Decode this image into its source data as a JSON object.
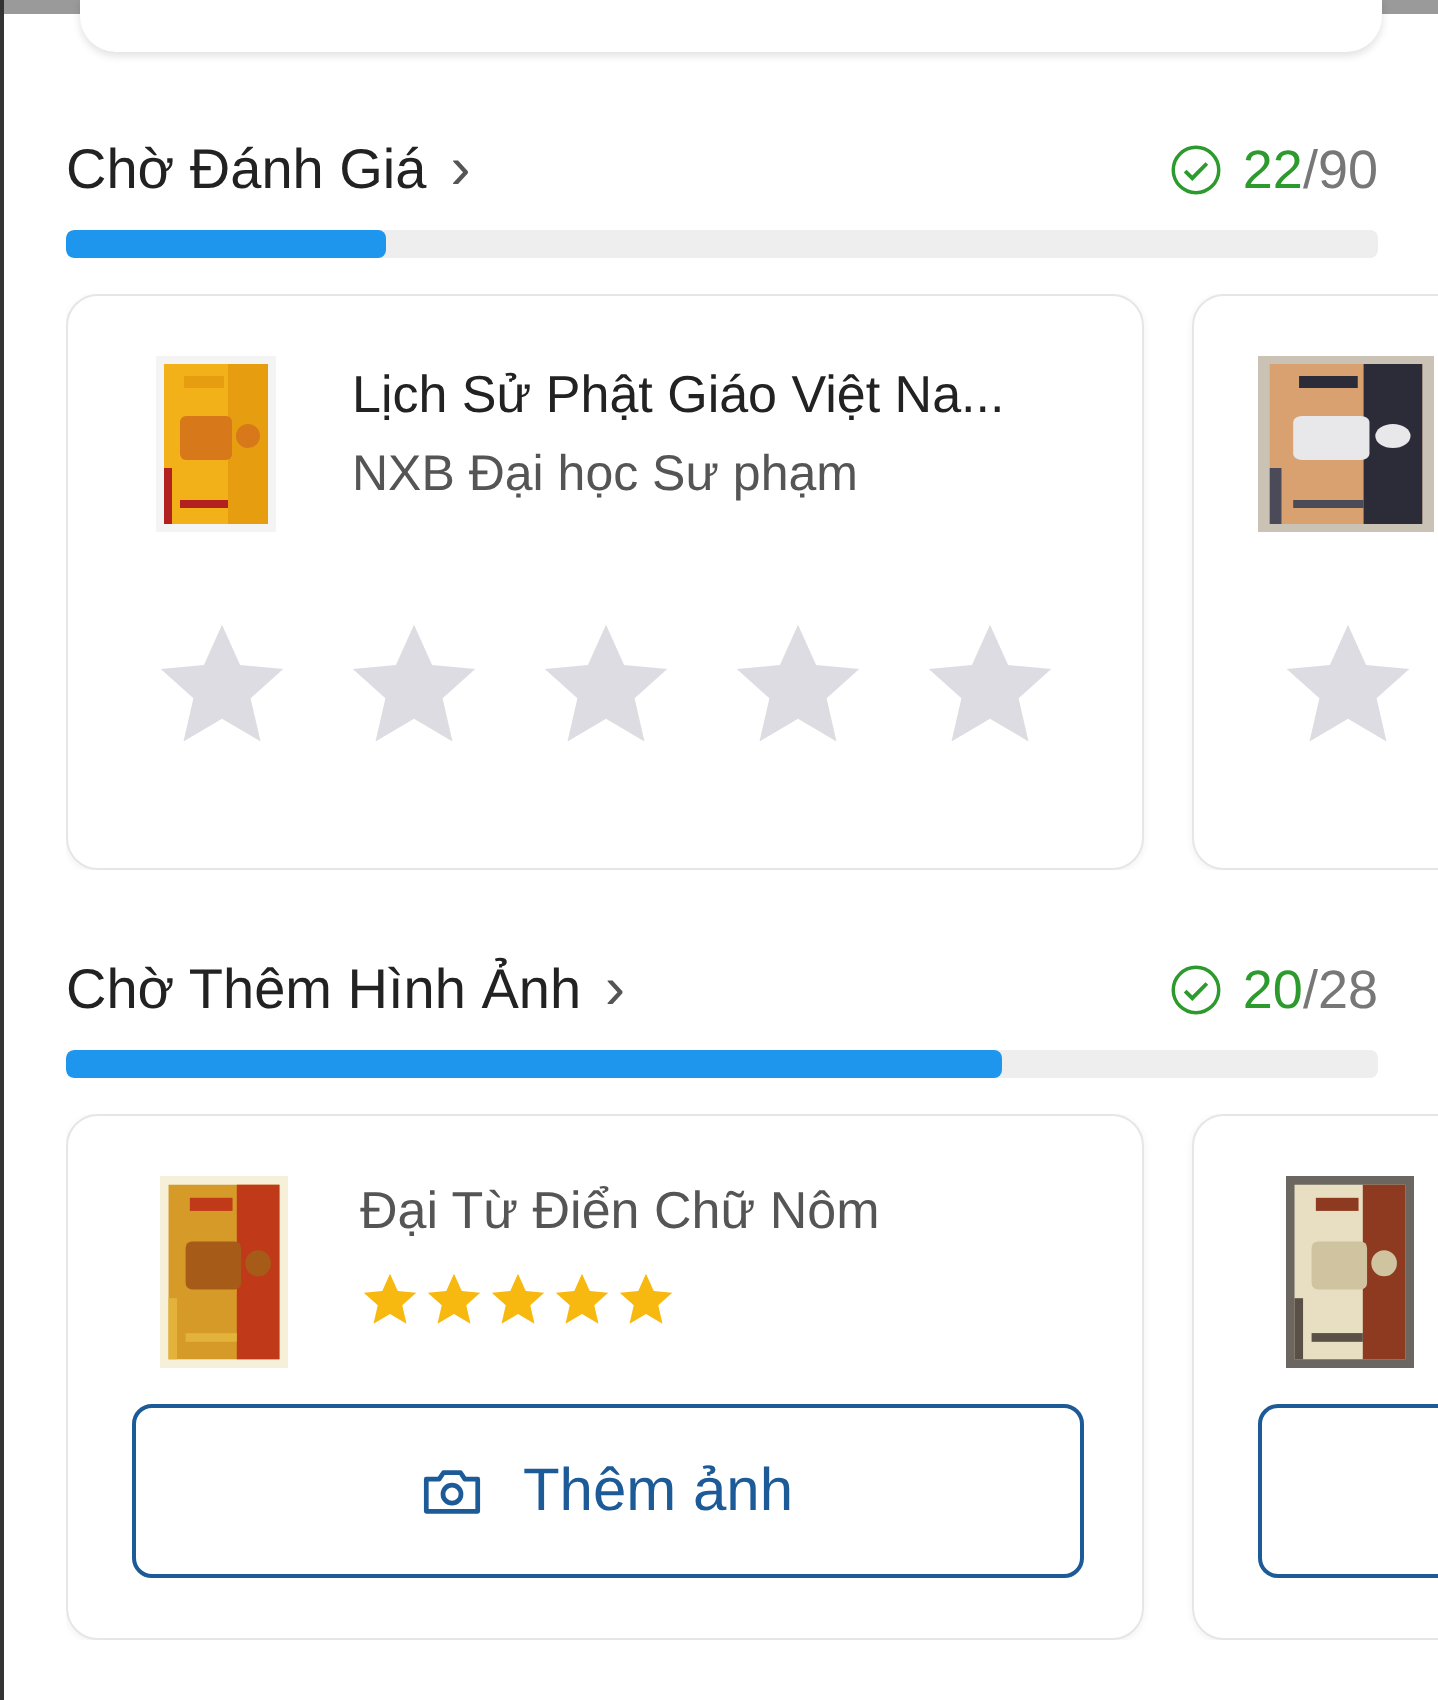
{
  "sections": [
    {
      "kind": "rate",
      "title": "Chờ Đánh Giá",
      "chevron": "›",
      "done": "22",
      "total": "/90",
      "level": 0.244,
      "cards": [
        {
          "cover": {
            "kind": "picture"
          },
          "title": "Lịch Sử Phật Giáo Việt Na...",
          "publisher": "NXB Đại học Sư phạm",
          "stars": 0
        },
        {
          "cover": {
            "kind": "picture"
          }
        }
      ]
    },
    {
      "title": "Chờ Thêm Hình Ảnh",
      "chevron": "›",
      "done": "20",
      "total": "/28",
      "level": 0.714,
      "cards": [
        {
          "cover": {
            "kind": "picture"
          },
          "title": "Đại Từ Điển Chữ Nôm",
          "stars": 5,
          "button": "Thêm ảnh"
        },
        {
          "cover": {
            "kind": "picture"
          },
          "has_button": true
        }
      ]
    }
  ]
}
